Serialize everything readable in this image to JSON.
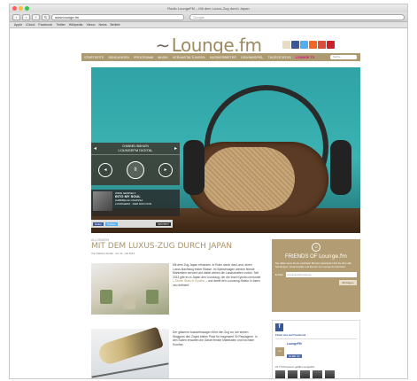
{
  "browser": {
    "window_title": "Radio LoungeFM – Mit dem Luxus-Zug durch Japan",
    "url": "www.lounge.fm",
    "search_placeholder": "Google",
    "bookmarks": [
      "Apple",
      "iCloud",
      "Facebook",
      "Twitter",
      "Wikipedia",
      "Yahoo",
      "News",
      "Beliebt"
    ]
  },
  "site": {
    "logo_text": "Lounge.fm",
    "social_colors": [
      "#f4f4f4",
      "#3b5998",
      "#55acee",
      "#f26522",
      "#dd4b39",
      "#cb2027"
    ],
    "nav": [
      "STARTSEITE",
      "SENDUNGEN",
      "PROGRAMM",
      "MUSIK",
      "VERANSTALTUNGEN",
      "MUSIKERBIETER",
      "GEWINNSPIEL",
      "TAGESSTATUS"
    ],
    "nav_live": "LOUNGE TV",
    "search_placeholder": "Suche",
    "accent": "#ad9a70"
  },
  "player": {
    "label": "CHANNEL WÄHLEN",
    "channel": "LOUNGEFM DIGITAL",
    "prev_icon": "◂",
    "next_icon": "▸",
    "rewind_icon": "◂",
    "play_icon": "II",
    "forward_icon": "▸"
  },
  "now_playing": {
    "label": "WIRD GESPIELT",
    "title": "INTO MY SOUL",
    "artist": "GABRIELLE CAVASSA",
    "extra": "LOUNGEFM · DER DON CON"
  },
  "share": {
    "facebook": "Teilen",
    "twitter": "Twittern",
    "spotify": "SPOTIFY"
  },
  "article": {
    "category": "ALLGEMEIN",
    "headline": "MIT DEM LUXUS-ZUG DURCH JAPAN",
    "meta": "Von Markus Fiedel · am 11. Juli 2014",
    "para1": "Mit dem Zug Japan erkunden: in Ruhe durch das Land, einen Luxus-Nachtzug erster Klasse. Im Speisewagen werden feinste Mahlzeiten serviert und dabei ziehen die Landschaften vorbei. Seit 2013 gibt es in Japan den Luxuszug, der die Insel Kyushu umrundet –",
    "para1_link": "Seven Stars in Kyushu",
    "para1_end": "– und damit den Luxuszug-Sektor in Asien neu definiert.",
    "para2": "Der gläserne Aussichtswagen führt den Zug an; die sieben Waggons des Zuges bieten Platz für insgesamt 30 Passagiere. In den Suiten erwarten die Gäste feinste Materialien und höchster Komfort."
  },
  "friends": {
    "title_a": "FRIENDS OF",
    "title_b": "Lounge.fm",
    "desc": "Sei dabei wenn Du es möchtest! Mit dem Newsletter bist Du über alle Sendungen, Gewinnspiele und Events von Lounge.fm informiert.",
    "email_label": "E-Mail",
    "email_placeholder": "Deine E-Mail-Adresse",
    "button": "Eintragen"
  },
  "facebook": {
    "find_label": "Finde uns auf Facebook",
    "page_name": "LoungeFM",
    "like_label": "Gefällt mir",
    "count_text": "24.774 Personen gefällt LoungeFM."
  }
}
